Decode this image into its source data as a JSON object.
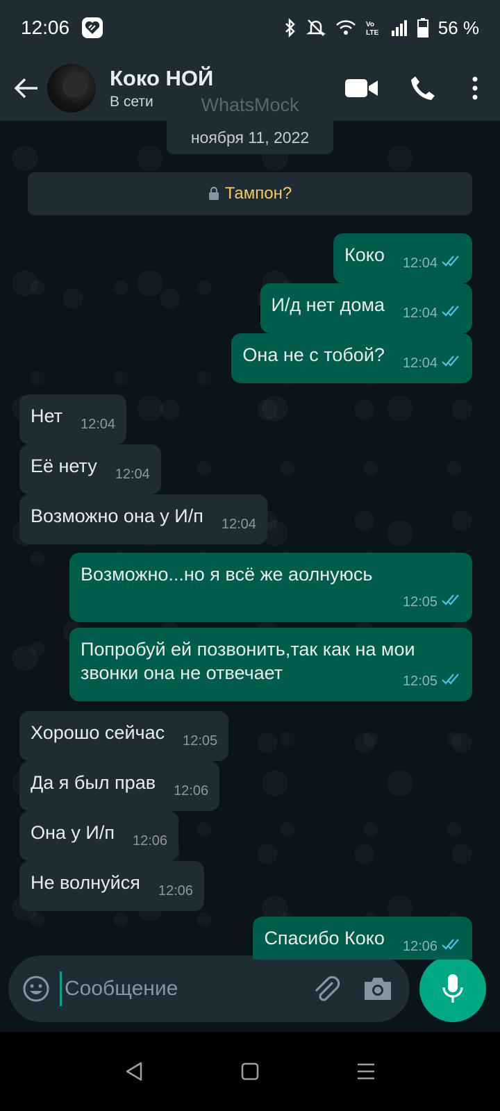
{
  "status_bar": {
    "time": "12:06",
    "battery": "56 %",
    "icons": [
      "bluetooth-icon",
      "mute-icon",
      "wifi-icon",
      "volte-icon",
      "signal-icon",
      "battery-icon"
    ]
  },
  "header": {
    "contact_name": "Коко НОЙ",
    "contact_status": "В сети",
    "watermark": "WhatsMock"
  },
  "chat": {
    "date_chip": "ноября 11, 2022",
    "encryption_note": "Тампон?",
    "messages": [
      {
        "dir": "out",
        "text": "Коко",
        "time": "12:04"
      },
      {
        "dir": "out",
        "text": "И/д нет дома",
        "time": "12:04"
      },
      {
        "dir": "out",
        "text": "Она не с тобой?",
        "time": "12:04"
      },
      {
        "dir": "in",
        "text": "Нет",
        "time": "12:04"
      },
      {
        "dir": "in",
        "text": "Её нету",
        "time": "12:04"
      },
      {
        "dir": "in",
        "text": "Возможно она у И/п",
        "time": "12:04"
      },
      {
        "dir": "out",
        "text": "Возможно...но я всё же аолнуюсь",
        "time": "12:05"
      },
      {
        "dir": "out",
        "text": "Попробуй ей позвонить,так как на мои звонки она не отвечает",
        "time": "12:05"
      },
      {
        "dir": "in",
        "text": "Хорошо сейчас",
        "time": "12:05"
      },
      {
        "dir": "in",
        "text": "Да я был прав",
        "time": "12:06"
      },
      {
        "dir": "in",
        "text": "Она у И/п",
        "time": "12:06"
      },
      {
        "dir": "in",
        "text": "Не волнуйся",
        "time": "12:06"
      },
      {
        "dir": "out",
        "text": "Спасибо Коко",
        "time": "12:06"
      }
    ]
  },
  "input": {
    "placeholder": "Сообщение",
    "value": ""
  },
  "colors": {
    "header_bg": "#1f2c34",
    "chat_bg": "#0b141a",
    "outgoing_bubble": "#005c4b",
    "incoming_bubble": "#202c33",
    "accent": "#00a884",
    "read_tick": "#53bdeb",
    "encryption_text": "#f8c95a"
  }
}
